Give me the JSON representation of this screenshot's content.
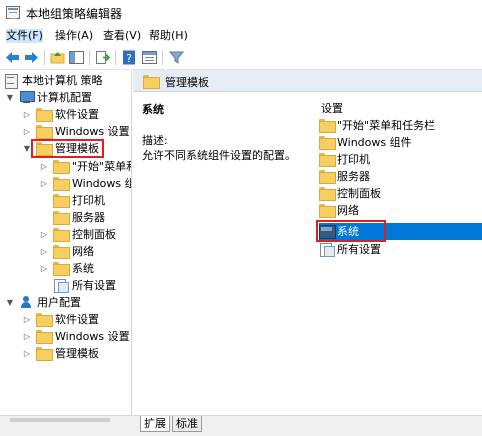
{
  "window": {
    "title": "本地组策略编辑器",
    "app_icon": "policy-editor-icon"
  },
  "menubar": {
    "items": [
      "文件(F)",
      "操作(A)",
      "查看(V)",
      "帮助(H)"
    ]
  },
  "toolbar": {
    "buttons": [
      "back-arrow-icon",
      "forward-arrow-icon",
      "up-folder-icon",
      "show-hide-tree-icon",
      "export-list-icon",
      "help-icon",
      "properties-icon",
      "filter-icon"
    ]
  },
  "tree": {
    "items": [
      {
        "label": "本地计算机 策略",
        "icon": "policy-icon"
      },
      {
        "label": "计算机配置",
        "icon": "computer-icon"
      },
      {
        "label": "软件设置",
        "icon": "folder-icon"
      },
      {
        "label": "Windows 设置",
        "icon": "folder-icon"
      },
      {
        "label": "管理模板",
        "icon": "folder-icon"
      },
      {
        "label": "\"开始\"菜单和",
        "icon": "folder-icon"
      },
      {
        "label": "Windows 组件",
        "icon": "folder-icon"
      },
      {
        "label": "打印机",
        "icon": "folder-icon"
      },
      {
        "label": "服务器",
        "icon": "folder-icon"
      },
      {
        "label": "控制面板",
        "icon": "folder-icon"
      },
      {
        "label": "网络",
        "icon": "folder-icon"
      },
      {
        "label": "系统",
        "icon": "folder-icon"
      },
      {
        "label": "所有设置",
        "icon": "all-settings-icon"
      },
      {
        "label": "用户配置",
        "icon": "user-icon"
      },
      {
        "label": "软件设置",
        "icon": "folder-icon"
      },
      {
        "label": "Windows 设置",
        "icon": "folder-icon"
      },
      {
        "label": "管理模板",
        "icon": "folder-icon"
      }
    ]
  },
  "right_pane": {
    "header": "管理模板",
    "description": {
      "title": "系统",
      "label": "描述:",
      "text": "允许不同系统组件设置的配置。"
    },
    "list_header": "设置",
    "items": [
      {
        "label": "\"开始\"菜单和任务栏",
        "icon": "folder-icon"
      },
      {
        "label": "Windows 组件",
        "icon": "folder-icon"
      },
      {
        "label": "打印机",
        "icon": "folder-icon"
      },
      {
        "label": "服务器",
        "icon": "folder-icon"
      },
      {
        "label": "控制面板",
        "icon": "folder-icon"
      },
      {
        "label": "网络",
        "icon": "folder-icon"
      },
      {
        "label": "系统",
        "icon": "system-folder-icon",
        "selected": true
      },
      {
        "label": "所有设置",
        "icon": "all-settings-icon"
      }
    ]
  },
  "status_tabs": [
    "扩展",
    "标准"
  ],
  "colors": {
    "selection": "#0078d7",
    "highlight_box": "#e02020",
    "pane_header": "#e6ecf3"
  }
}
